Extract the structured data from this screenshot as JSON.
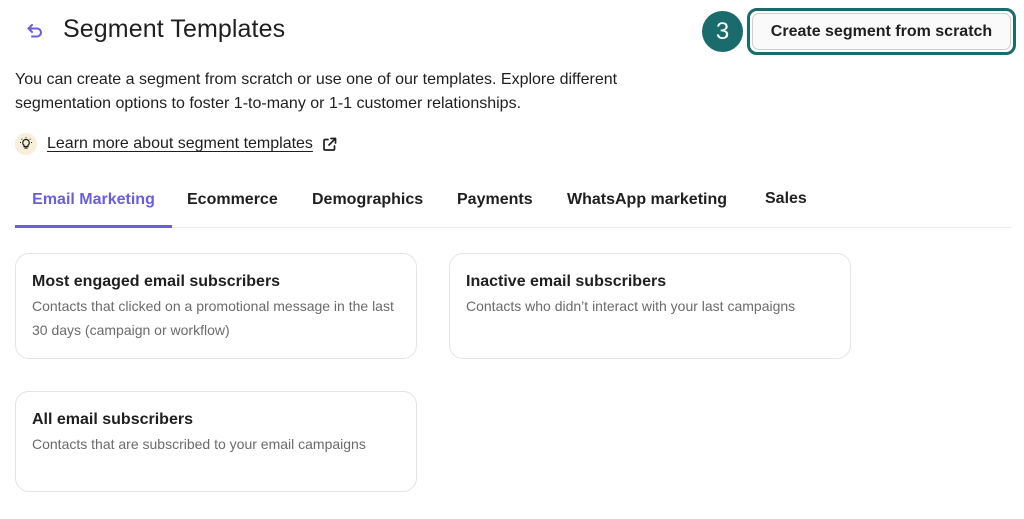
{
  "header": {
    "back_icon": "undo-arrow-icon",
    "title": "Segment Templates",
    "step_badge": "3",
    "create_button_label": "Create segment from scratch"
  },
  "intro": {
    "text": "You can create a segment from scratch or use one of our templates. Explore different segmentation options to foster 1-to-many or 1-1 customer relationships."
  },
  "learn_more": {
    "icon": "lightbulb-icon",
    "label": "Learn more about segment templates",
    "trailing_icon": "external-link-icon"
  },
  "tabs": [
    {
      "label": "Email Marketing",
      "active": true
    },
    {
      "label": "Ecommerce",
      "active": false
    },
    {
      "label": "Demographics",
      "active": false
    },
    {
      "label": "Payments",
      "active": false
    },
    {
      "label": "WhatsApp marketing",
      "active": false
    },
    {
      "label": "Sales",
      "active": false
    }
  ],
  "cards": [
    {
      "title": "Most engaged email subscribers",
      "description": "Contacts that clicked on a promotional message in the last 30 days (campaign or workflow)"
    },
    {
      "title": "Inactive email subscribers",
      "description": "Contacts who didn’t interact with your last campaigns"
    },
    {
      "title": "All email subscribers",
      "description": "Contacts that are subscribed to your email campaigns"
    }
  ],
  "colors": {
    "accent": "#6a5fdb",
    "step_badge": "#1a6b6b",
    "bulb_bg": "#f7efd9"
  }
}
